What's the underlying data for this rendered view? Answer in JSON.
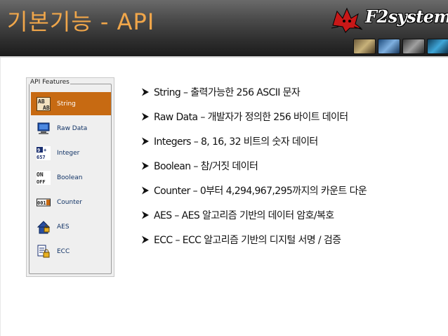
{
  "header": {
    "title": "기본기능 - API",
    "logo_text": "F2system",
    "logo_icon": "cat-logo-icon",
    "thumbnails": [
      "product-thumb-1",
      "product-thumb-2",
      "product-thumb-3",
      "product-thumb-4"
    ]
  },
  "panel": {
    "legend": "API Features",
    "items": [
      {
        "label": "String",
        "icon": "string-icon",
        "selected": true
      },
      {
        "label": "Raw Data",
        "icon": "raw-data-icon",
        "selected": false
      },
      {
        "label": "Integer",
        "icon": "integer-icon",
        "selected": false
      },
      {
        "label": "Boolean",
        "icon": "boolean-icon",
        "selected": false
      },
      {
        "label": "Counter",
        "icon": "counter-icon",
        "selected": false
      },
      {
        "label": "AES",
        "icon": "aes-icon",
        "selected": false
      },
      {
        "label": "ECC",
        "icon": "ecc-icon",
        "selected": false
      }
    ]
  },
  "bullets": [
    "String – 출력가능한 256 ASCII 문자",
    "Raw Data – 개발자가 정의한 256 바이트 데이터",
    "Integers – 8, 16, 32 비트의 숫자 데이터",
    "Boolean – 참/거짓 데이터",
    "Counter – 0부터 4,294,967,295까지의 카운트 다운",
    "AES – AES 알고리즘 기반의 데이터 암호/복호",
    "ECC – ECC 알고리즘 기반의  디지털 서명 / 검증"
  ],
  "colors": {
    "title": "#f0a64a",
    "selected_item": "#c76a12",
    "item_label": "#113366",
    "bullet_arrow": "#111111"
  }
}
